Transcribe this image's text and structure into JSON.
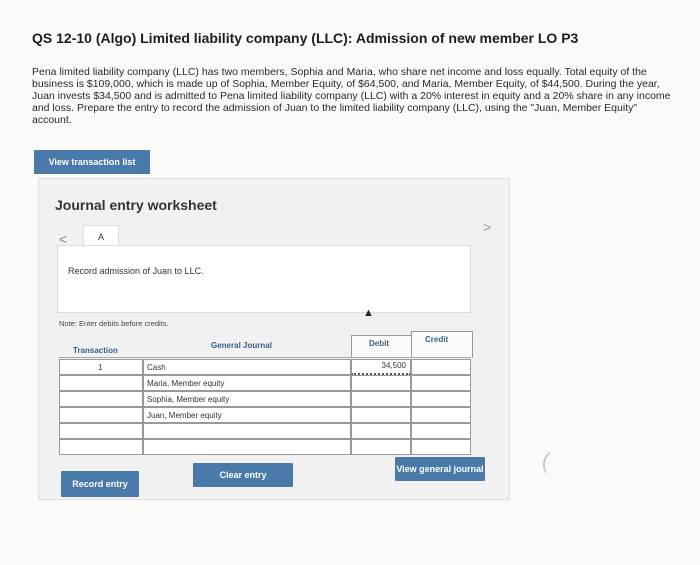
{
  "header": {
    "title": "QS 12-10 (Algo) Limited liability company (LLC): Admission of new member LO P3",
    "problem_text": "Pena limited liability company (LLC) has two members, Sophia and Maria, who share net income and loss equally. Total equity of the business is $109,000, which is made up of Sophia, Member Equity, of $64,500, and Maria, Member Equity, of $44,500. During the year, Juan invests $34,500 and is admitted to Pena limited liability company (LLC) with a 20% interest in equity and a 20% share in any income and loss. Prepare the entry to record the admission of Juan to the limited liability company (LLC), using the \"Juan, Member Equity\" account."
  },
  "buttons": {
    "view_transaction_list": "View transaction list",
    "record_entry": "Record entry",
    "clear_entry": "Clear entry",
    "view_general_journal": "View general journal"
  },
  "worksheet": {
    "title": "Journal entry worksheet",
    "nav_prev": "<",
    "nav_next": ">",
    "tab_label": "A",
    "instruction": "Record admission of Juan to LLC.",
    "note": "Note: Enter debits before credits."
  },
  "journal": {
    "headers": {
      "transaction": "Transaction",
      "general_journal": "General Journal",
      "debit": "Debit",
      "credit": "Credit"
    },
    "rows": [
      {
        "transaction": "1",
        "account": "Cash",
        "debit": "34,500",
        "credit": ""
      },
      {
        "transaction": "",
        "account": "Maria, Member equity",
        "debit": "",
        "credit": ""
      },
      {
        "transaction": "",
        "account": "Sophia, Member equity",
        "debit": "",
        "credit": ""
      },
      {
        "transaction": "",
        "account": "Juan, Member equity",
        "debit": "",
        "credit": ""
      },
      {
        "transaction": "",
        "account": "",
        "debit": "",
        "credit": ""
      },
      {
        "transaction": "",
        "account": "",
        "debit": "",
        "credit": ""
      }
    ]
  },
  "colors": {
    "button_blue": "#4a7aaa",
    "header_blue": "#3a5f86",
    "panel_bg": "#f1f1f1"
  }
}
